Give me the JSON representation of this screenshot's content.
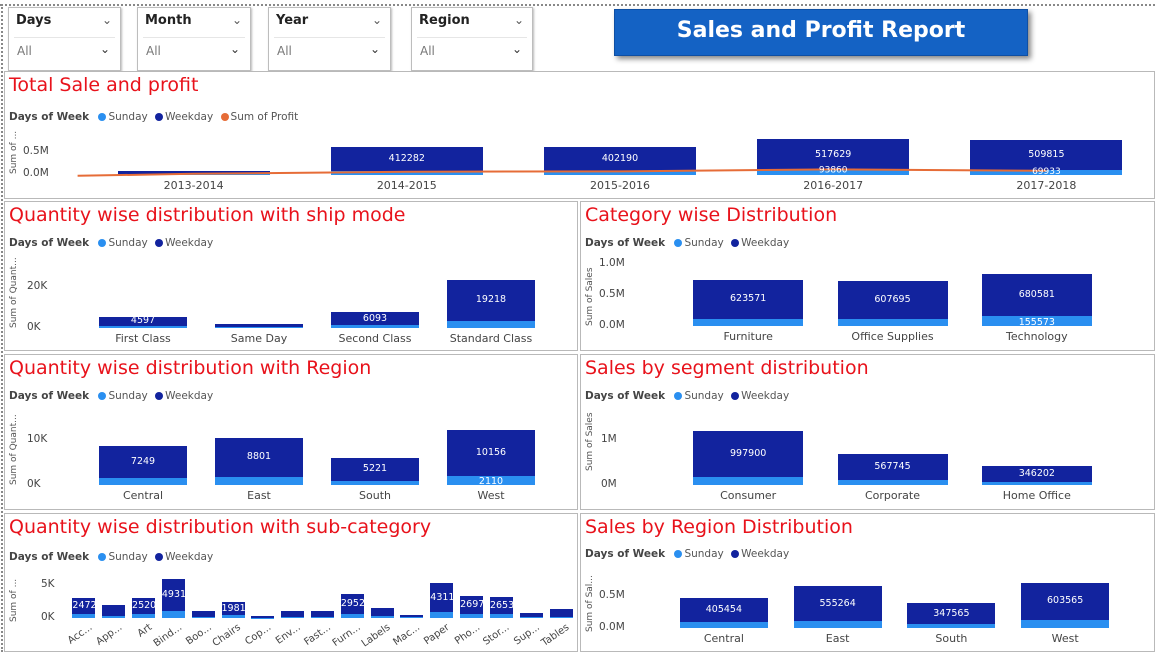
{
  "filters": [
    {
      "header": "Days",
      "value": "All"
    },
    {
      "header": "Month",
      "value": "All"
    },
    {
      "header": "Year",
      "value": "All"
    },
    {
      "header": "Region",
      "value": "All"
    }
  ],
  "report_title": "Sales and Profit Report",
  "legend": {
    "field": "Days of Week",
    "sunday": "Sunday",
    "weekday": "Weekday",
    "profit": "Sum of Profit"
  },
  "colors": {
    "weekday": "#12239e",
    "sunday": "#2a8ff0",
    "profit": "#e66c37",
    "title": "#e8121b"
  },
  "panels": {
    "p1": {
      "title": "Total Sale and profit",
      "ytitle": "Sum of ...",
      "ticks": [
        "0.5M",
        "0.0M"
      ]
    },
    "p2": {
      "title": "Quantity wise distribution with ship mode",
      "ytitle": "Sum of Quant...",
      "ticks": [
        "20K",
        "0K"
      ]
    },
    "p3": {
      "title": "Category wise Distribution",
      "ytitle": "Sum of Sales",
      "ticks": [
        "1.0M",
        "0.5M",
        "0.0M"
      ]
    },
    "p4": {
      "title": "Quantity wise distribution with Region",
      "ytitle": "Sum of Quant...",
      "ticks": [
        "10K",
        "0K"
      ]
    },
    "p5": {
      "title": "Sales by segment distribution",
      "ytitle": "Sum of Sales",
      "ticks": [
        "1M",
        "0M"
      ]
    },
    "p6": {
      "title": "Quantity wise distribution with sub-category",
      "ytitle": "Sum of ...",
      "ticks": [
        "5K",
        "0K"
      ]
    },
    "p7": {
      "title": "Sales by Region Distribution",
      "ytitle": "Sum of Sal...",
      "ticks": [
        "0.5M",
        "0.0M"
      ]
    }
  },
  "chart_data": [
    {
      "id": "p1",
      "type": "bar",
      "stacked": true,
      "ymax": 650000,
      "categories": [
        "2013-2014",
        "2014-2015",
        "2015-2016",
        "2016-2017",
        "2017-2018"
      ],
      "series": [
        {
          "name": "Sunday",
          "values": [
            10000,
            60000,
            60000,
            80000,
            80000
          ],
          "labels": [
            "",
            "",
            "",
            "",
            ""
          ]
        },
        {
          "name": "Weekday",
          "values": [
            60000,
            412282,
            402190,
            517629,
            509815
          ],
          "labels": [
            "",
            "412282",
            "402190",
            "517629",
            "509815"
          ]
        },
        {
          "name": "Sum of Profit",
          "type": "line",
          "values": [
            20000,
            55000,
            60000,
            93860,
            69933
          ],
          "labels": [
            "",
            "",
            "",
            "93860",
            "69933"
          ]
        }
      ]
    },
    {
      "id": "p2",
      "type": "bar",
      "stacked": true,
      "ymax": 26000,
      "categories": [
        "First Class",
        "Same Day",
        "Second Class",
        "Standard Class"
      ],
      "series": [
        {
          "name": "Sunday",
          "values": [
            800,
            300,
            1300,
            3500
          ],
          "labels": [
            "",
            "",
            "",
            ""
          ]
        },
        {
          "name": "Weekday",
          "values": [
            4597,
            1600,
            6093,
            19218
          ],
          "labels": [
            "4597",
            "",
            "6093",
            "19218"
          ]
        }
      ]
    },
    {
      "id": "p3",
      "type": "bar",
      "stacked": true,
      "ymax": 1100000,
      "categories": [
        "Furniture",
        "Office Supplies",
        "Technology"
      ],
      "series": [
        {
          "name": "Sunday",
          "values": [
            118000,
            115000,
            155573
          ],
          "labels": [
            "",
            "",
            "155573"
          ]
        },
        {
          "name": "Weekday",
          "values": [
            623571,
            607695,
            680581
          ],
          "labels": [
            "623571",
            "607695",
            "680581"
          ]
        }
      ]
    },
    {
      "id": "p4",
      "type": "bar",
      "stacked": true,
      "ymax": 13000,
      "categories": [
        "Central",
        "East",
        "South",
        "West"
      ],
      "series": [
        {
          "name": "Sunday",
          "values": [
            1500,
            1800,
            900,
            2110
          ],
          "labels": [
            "",
            "",
            "",
            "2110"
          ]
        },
        {
          "name": "Weekday",
          "values": [
            7249,
            8801,
            5221,
            10156
          ],
          "labels": [
            "7249",
            "8801",
            "5221",
            "10156"
          ]
        }
      ]
    },
    {
      "id": "p5",
      "type": "bar",
      "stacked": true,
      "ymax": 1250000,
      "categories": [
        "Consumer",
        "Corporate",
        "Home Office"
      ],
      "series": [
        {
          "name": "Sunday",
          "values": [
            170000,
            100000,
            70000
          ],
          "labels": [
            "",
            "",
            ""
          ]
        },
        {
          "name": "Weekday",
          "values": [
            997900,
            567745,
            346202
          ],
          "labels": [
            "997900",
            "567745",
            "346202"
          ]
        }
      ]
    },
    {
      "id": "p6",
      "type": "bar",
      "stacked": true,
      "ymax": 7000,
      "rotate": true,
      "categories": [
        "Acc...",
        "App...",
        "Art",
        "Bind...",
        "Boo...",
        "Chairs",
        "Cop...",
        "Env...",
        "Fast...",
        "Furn...",
        "Labels",
        "Mac...",
        "Paper",
        "Pho...",
        "Stor...",
        "Sup...",
        "Tables"
      ],
      "series": [
        {
          "name": "Sunday",
          "values": [
            550,
            350,
            550,
            1050,
            200,
            450,
            60,
            120,
            120,
            650,
            270,
            80,
            950,
            600,
            550,
            120,
            220
          ],
          "labels": [
            "",
            "",
            "",
            "",
            "",
            "",
            "",
            "",
            "",
            "",
            "",
            "",
            "",
            "",
            "",
            "",
            ""
          ]
        },
        {
          "name": "Weekday",
          "values": [
            2472,
            1700,
            2520,
            4931,
            900,
            1981,
            200,
            900,
            900,
            2952,
            1300,
            400,
            4311,
            2697,
            2653,
            600,
            1100
          ],
          "labels": [
            "2472",
            "",
            "2520",
            "4931",
            "",
            "1981",
            "",
            "",
            "",
            "2952",
            "",
            "",
            "4311",
            "2697",
            "2653",
            "",
            ""
          ]
        }
      ]
    },
    {
      "id": "p7",
      "type": "bar",
      "stacked": true,
      "ymax": 780000,
      "categories": [
        "Central",
        "East",
        "South",
        "West"
      ],
      "series": [
        {
          "name": "Sunday",
          "values": [
            90000,
            120000,
            60000,
            130000
          ],
          "labels": [
            "",
            "",
            "",
            ""
          ]
        },
        {
          "name": "Weekday",
          "values": [
            405454,
            555264,
            347565,
            603565
          ],
          "labels": [
            "405454",
            "555264",
            "347565",
            "603565"
          ]
        }
      ]
    }
  ]
}
